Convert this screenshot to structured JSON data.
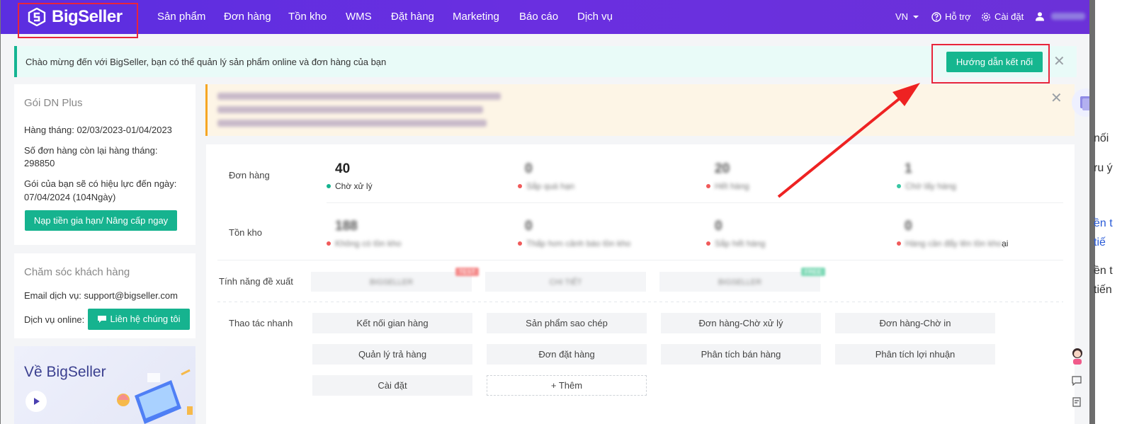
{
  "brand": {
    "name": "BigSeller"
  },
  "nav": {
    "items": [
      "Sản phẩm",
      "Đơn hàng",
      "Tồn kho",
      "WMS",
      "Đặt hàng",
      "Marketing",
      "Báo cáo",
      "Dịch vụ"
    ],
    "language": "VN",
    "help": "Hỗ trợ",
    "settings": "Cài đặt"
  },
  "welcome": {
    "message": "Chào mừng đến với BigSeller, bạn có thể quản lý sản phẩm online và đơn hàng của bạn",
    "button": "Hướng dẫn kết nối"
  },
  "plan": {
    "title": "Gói DN Plus",
    "monthly": "Hàng tháng: 02/03/2023-01/04/2023",
    "remaining_label": "Số đơn hàng còn lại hàng tháng:",
    "remaining_value": "298850",
    "valid_label": "Gói của bạn sẽ có hiệu lực đến ngày:",
    "valid_value": "07/04/2024 (104Ngày)",
    "button": "Nạp tiền gia hạn/ Nâng cấp ngay"
  },
  "support": {
    "title": "Chăm sóc khách hàng",
    "email": "Email dịch vụ: support@bigseller.com",
    "online_label": "Dịch vụ online:",
    "button": "Liên hệ chúng tôi"
  },
  "about": {
    "title": "Về BigSeller"
  },
  "dashboard": {
    "orders_label": "Đơn hàng",
    "orders": [
      {
        "value": "40",
        "label": "Chờ xử lý",
        "color": "#16b38f"
      },
      {
        "value": "0",
        "label": "Sắp quá hạn",
        "color": "#f05a5a"
      },
      {
        "value": "20",
        "label": "Hết hàng",
        "color": "#f05a5a"
      },
      {
        "value": "1",
        "label": "Chờ lấy hàng",
        "color": "#39c6a3"
      }
    ],
    "stock_label": "Tồn kho",
    "stock": [
      {
        "value": "188",
        "label": "Không có tồn kho",
        "color": "#f05a5a"
      },
      {
        "value": "0",
        "label": "Thấp hơn cảnh báo tồn kho",
        "color": "#f05a5a"
      },
      {
        "value": "0",
        "label": "Sắp hết hàng",
        "color": "#f05a5a"
      },
      {
        "value": "0",
        "label": "Hàng cần đẩy lên tồn kho",
        "color": "#f05a5a",
        "suffix": "ại"
      }
    ],
    "features_label": "Tính năng đề xuất",
    "features": [
      {
        "label": "BIGSELLER",
        "tag": "TEST",
        "tag_color": "#f58b8b"
      },
      {
        "label": "CHI TIẾT",
        "tag": "",
        "tag_color": ""
      },
      {
        "label": "BIGSELLER",
        "tag": "FREE",
        "tag_color": "#7ed9b6"
      }
    ],
    "quick_label": "Thao tác nhanh",
    "quick": [
      "Kết nối gian hàng",
      "Sản phẩm sao chép",
      "Đơn hàng-Chờ xử lý",
      "Đơn hàng-Chờ in",
      "Quản lý trả hàng",
      "Đơn đặt hàng",
      "Phân tích bán hàng",
      "Phân tích lợi nhuận",
      "Cài đặt"
    ],
    "add_label": "+ Thêm"
  },
  "background_page": {
    "fragments": [
      {
        "text": "nối",
        "link": false
      },
      {
        "text": "ru ý",
        "link": false
      },
      {
        "text": "ền t",
        "link": true
      },
      {
        "text": "tiế",
        "link": true
      },
      {
        "text": "ền t",
        "link": false
      },
      {
        "text": "tiến",
        "link": false
      }
    ]
  },
  "colors": {
    "accent": "#16b38f",
    "nav_from": "#5b2ee0",
    "nav_to": "#6b31d8",
    "highlight": "#e8253b"
  }
}
